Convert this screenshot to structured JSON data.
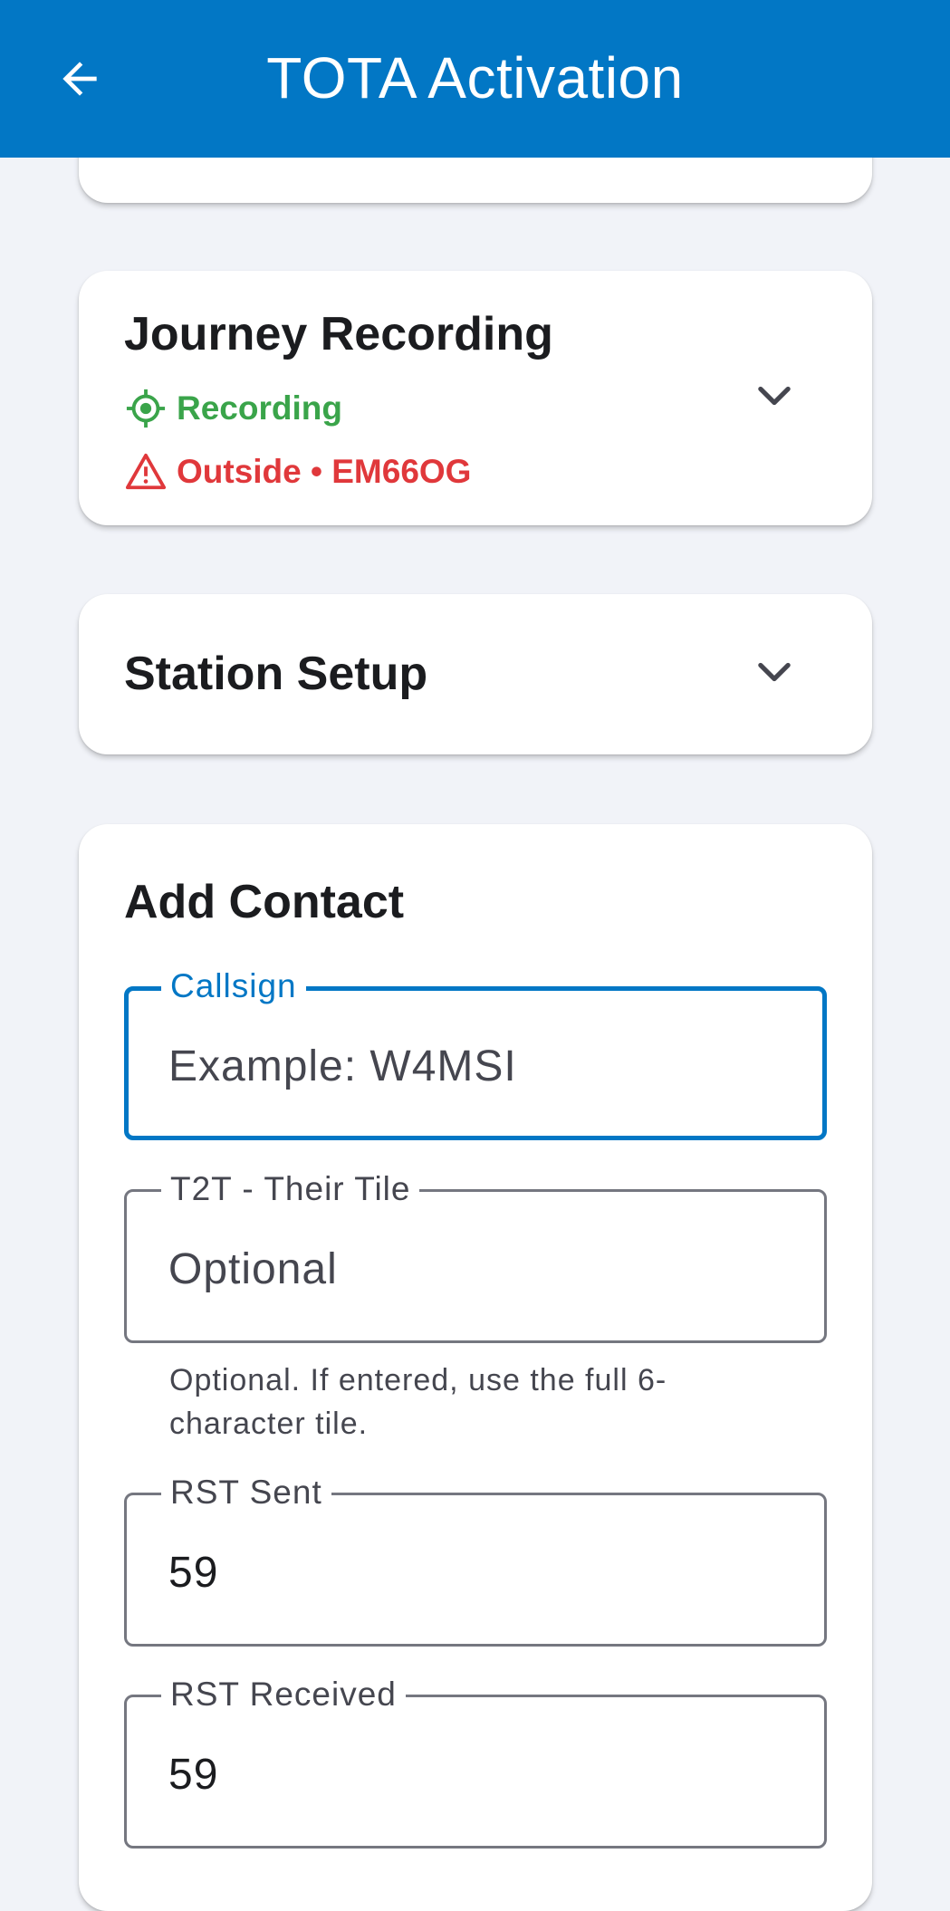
{
  "app_bar": {
    "title": "TOTA Activation",
    "back_icon": "arrow-left-icon",
    "color": "#0277c5"
  },
  "journey_recording": {
    "title": "Journey Recording",
    "recording_status": "Recording",
    "location_status": "Outside • EM66OG",
    "recording_color": "#3aa44a",
    "warning_color": "#e0383b",
    "expand_icon": "chevron-down-icon"
  },
  "station_setup": {
    "title": "Station Setup",
    "expand_icon": "chevron-down-icon"
  },
  "add_contact": {
    "title": "Add Contact",
    "callsign": {
      "label": "Callsign",
      "value": "",
      "placeholder": "Example: W4MSI"
    },
    "their_tile": {
      "label": "T2T - Their Tile",
      "value": "",
      "placeholder": "Optional",
      "helper": "Optional. If entered, use the full 6-character tile."
    },
    "rst_sent": {
      "label": "RST Sent",
      "value": "59"
    },
    "rst_received": {
      "label": "RST Received",
      "value": "59"
    }
  }
}
